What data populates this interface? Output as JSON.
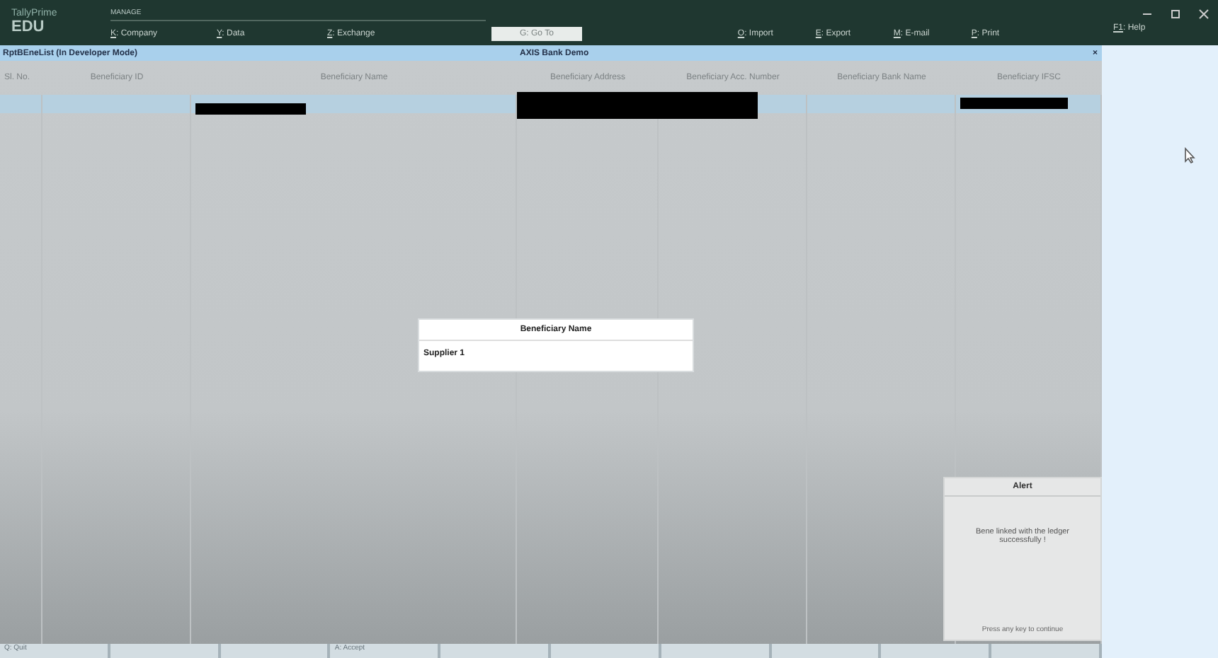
{
  "app": {
    "product": "TallyPrime",
    "edition": "EDU",
    "mode": "MANAGE"
  },
  "menu": [
    {
      "key": "K",
      "label": ": Company"
    },
    {
      "key": "Y",
      "label": ": Data"
    },
    {
      "key": "Z",
      "label": ": Exchange"
    }
  ],
  "goto": {
    "label": "G: Go To"
  },
  "menu_right": [
    {
      "key": "O",
      "label": ": Import"
    },
    {
      "key": "E",
      "label": ": Export"
    },
    {
      "key": "M",
      "label": ": E-mail"
    },
    {
      "key": "P",
      "label": ": Print"
    },
    {
      "key": "F1",
      "label": ": Help"
    }
  ],
  "report": {
    "title": "RptBEneList (In Developer Mode)",
    "company": "AXIS Bank Demo",
    "close": "×"
  },
  "table": {
    "columns": [
      "Sl. No.",
      "Beneficiary ID",
      "Beneficiary Name",
      "Beneficiary Address",
      "Beneficiary Acc. Number",
      "Beneficiary Bank Name",
      "Beneficiary IFSC"
    ],
    "rows": [
      {
        "selected": true,
        "cells": [
          {
            "kind": "blank"
          },
          {
            "kind": "blank"
          },
          {
            "kind": "redacted"
          },
          {
            "kind": "redacted"
          },
          {
            "kind": "blank"
          },
          {
            "kind": "blank"
          },
          {
            "kind": "redacted"
          }
        ]
      }
    ]
  },
  "popup": {
    "title": "Beneficiary Name",
    "value": "Supplier 1"
  },
  "alert": {
    "title": "Alert",
    "message": "Bene linked with the ledger successfully !",
    "hint": "Press any key to continue"
  },
  "buttons": [
    {
      "kind": "labeled",
      "label": "Q: Quit"
    },
    {
      "kind": "blank"
    },
    {
      "kind": "blank"
    },
    {
      "kind": "labeled",
      "label": "A: Accept"
    },
    {
      "kind": "blank"
    },
    {
      "kind": "blank"
    },
    {
      "kind": "blank"
    },
    {
      "kind": "blank"
    },
    {
      "kind": "blank"
    },
    {
      "kind": "blank"
    }
  ]
}
